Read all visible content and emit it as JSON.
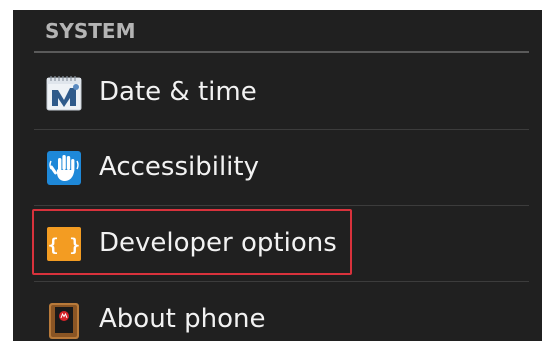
{
  "section": {
    "title": "SYSTEM"
  },
  "items": [
    {
      "label": "Date & time",
      "icon": "calendar-clock-icon"
    },
    {
      "label": "Accessibility",
      "icon": "hand-icon"
    },
    {
      "label": "Developer options",
      "icon": "braces-icon"
    },
    {
      "label": "About phone",
      "icon": "phone-icon"
    }
  ],
  "colors": {
    "background": "#202020",
    "text": "#f2f2f2",
    "section_title": "#b4b4b4",
    "highlight": "#d8323c",
    "developer_icon": "#f39c22",
    "accessibility_icon": "#1e88d8"
  }
}
